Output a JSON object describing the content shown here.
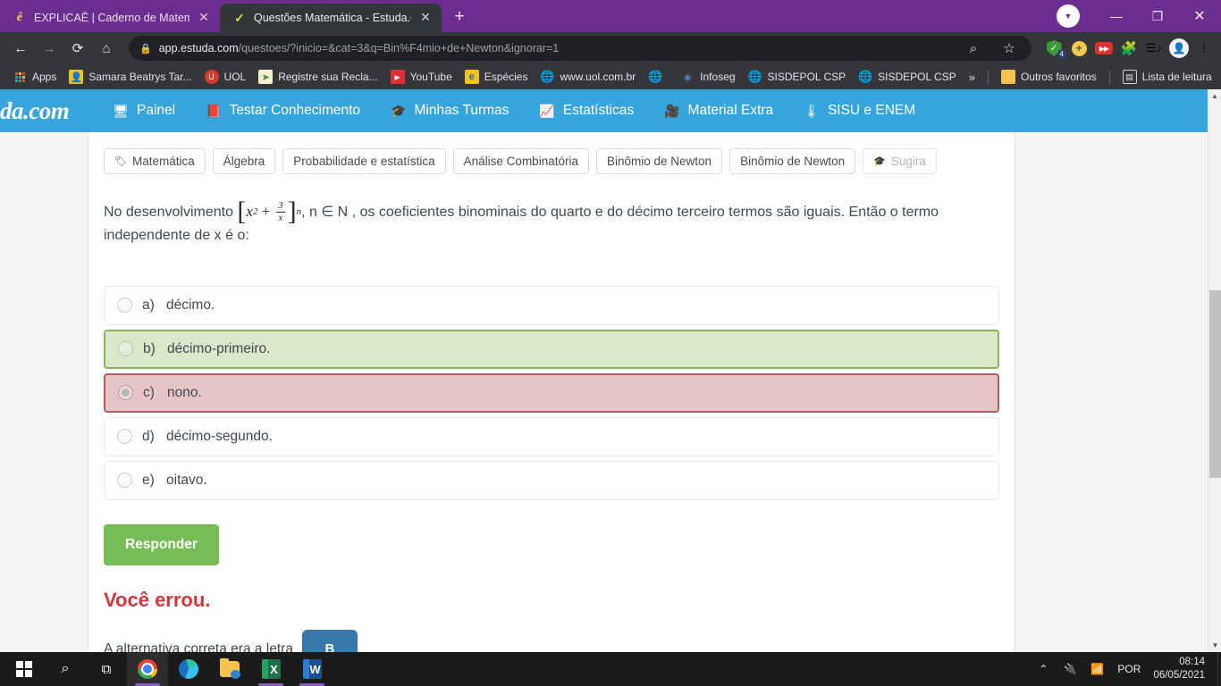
{
  "browser": {
    "tabs": [
      {
        "title": "EXPLICAÊ | Caderno de Matemáti",
        "favicon": "e-italic-icon",
        "active": false
      },
      {
        "title": "Questões Matemática - Estuda.co",
        "favicon": "green-check-icon",
        "active": true
      }
    ],
    "new_tab_label": "+",
    "window_controls": {
      "minimize": "—",
      "maximize": "❐",
      "close": "✕"
    },
    "nav": {
      "back": "←",
      "forward": "→",
      "reload": "⟳",
      "home": "⌂"
    },
    "omnibox": {
      "lock_icon": "lock-icon",
      "url_domain": "app.estuda.com",
      "url_path": "/questoes/?inicio=&cat=3&q=Bin%F4mio+de+Newton&ignorar=1",
      "zoom_icon": "magnifier-icon",
      "star_icon": "star-icon"
    },
    "extensions": [
      {
        "name": "adblock-shield-icon",
        "badge": "4"
      },
      {
        "name": "plus-circle-icon",
        "badge": ""
      },
      {
        "name": "youtube-downloader-icon",
        "badge": ""
      },
      {
        "name": "puzzle-extensions-icon",
        "badge": ""
      },
      {
        "name": "media-list-icon",
        "badge": ""
      },
      {
        "name": "profile-avatar-icon",
        "badge": ""
      },
      {
        "name": "chrome-menu-icon",
        "badge": ""
      }
    ],
    "bookmarks": [
      {
        "label": "Apps",
        "icon": "apps-grid-icon"
      },
      {
        "label": "Samara Beatrys Tar...",
        "icon": "contact-icon"
      },
      {
        "label": "UOL",
        "icon": "uol-icon"
      },
      {
        "label": "Registre sua Recla...",
        "icon": "arrow-badge-icon"
      },
      {
        "label": "YouTube",
        "icon": "youtube-icon"
      },
      {
        "label": "Espécies",
        "icon": "especies-icon"
      },
      {
        "label": "www.uol.com.br",
        "icon": "globe-icon"
      },
      {
        "label": "",
        "icon": "globe-icon"
      },
      {
        "label": "Infoseg",
        "icon": "infoseg-icon"
      },
      {
        "label": "SISDEPOL CSP",
        "icon": "globe-icon"
      },
      {
        "label": "SISDEPOL CSP",
        "icon": "globe-icon"
      }
    ],
    "bookmarks_overflow": "»",
    "bookmarks_right": [
      {
        "label": "Outros favoritos",
        "icon": "folder-icon"
      },
      {
        "label": "Lista de leitura",
        "icon": "reading-list-icon"
      }
    ]
  },
  "site": {
    "logo": "da.com",
    "accent_color": "#37a5dd",
    "nav_items": [
      {
        "label": "Painel",
        "icon": "monitor-icon"
      },
      {
        "label": "Testar Conhecimento",
        "icon": "book-icon"
      },
      {
        "label": "Minhas Turmas",
        "icon": "graduation-cap-icon"
      },
      {
        "label": "Estatísticas",
        "icon": "chart-icon"
      },
      {
        "label": "Material Extra",
        "icon": "video-camera-icon"
      },
      {
        "label": "SISU e ENEM",
        "icon": "thermometer-icon"
      }
    ]
  },
  "question": {
    "tags": [
      {
        "label": "Matemática",
        "icon": "tag-icon",
        "muted": false
      },
      {
        "label": "Álgebra",
        "icon": "",
        "muted": false
      },
      {
        "label": "Probabilidade e estatística",
        "icon": "",
        "muted": false
      },
      {
        "label": "Análise Combinatória",
        "icon": "",
        "muted": false
      },
      {
        "label": "Binômio de Newton",
        "icon": "",
        "muted": false
      },
      {
        "label": "Binômio de Newton",
        "icon": "",
        "muted": false
      },
      {
        "label": "Sugira",
        "icon": "graduation-cap-icon",
        "muted": true
      }
    ],
    "text_before_formula": "No desenvolvimento",
    "formula": {
      "open_bracket": "[",
      "base": "x",
      "base_exponent": "2",
      "operator": "+",
      "fraction_numerator": "3",
      "fraction_denominator": "x",
      "close_bracket": "]",
      "power": "n"
    },
    "text_after_formula": ", n ∈ N , os coeficientes binominais do quarto e do décimo terceiro termos são iguais. Então o termo independente de x é o:",
    "options": [
      {
        "letter": "a)",
        "text": "décimo.",
        "selected": false,
        "state": "neutral"
      },
      {
        "letter": "b)",
        "text": "décimo-primeiro.",
        "selected": false,
        "state": "correct"
      },
      {
        "letter": "c)",
        "text": "nono.",
        "selected": true,
        "state": "wrong"
      },
      {
        "letter": "d)",
        "text": "décimo-segundo.",
        "selected": false,
        "state": "neutral"
      },
      {
        "letter": "e)",
        "text": "oitavo.",
        "selected": false,
        "state": "neutral"
      }
    ],
    "submit_label": "Responder",
    "feedback_title": "Você errou.",
    "feedback_text": "A alternativa correta era a letra",
    "correct_letter": "B",
    "correct_letter_color": "#3778ab",
    "error_color": "#d9343a",
    "submit_color": "#76bd55"
  },
  "taskbar": {
    "items": [
      {
        "name": "start-button",
        "icon": "windows-logo-icon"
      },
      {
        "name": "search-button",
        "icon": "magnifier-icon"
      },
      {
        "name": "task-view-button",
        "icon": "task-view-icon"
      },
      {
        "name": "chrome-taskbar-item",
        "icon": "chrome-icon"
      },
      {
        "name": "edge-taskbar-item",
        "icon": "edge-icon"
      },
      {
        "name": "file-explorer-taskbar-item",
        "icon": "folder-icon"
      },
      {
        "name": "excel-taskbar-item",
        "icon": "excel-icon"
      },
      {
        "name": "word-taskbar-item",
        "icon": "word-icon"
      }
    ],
    "tray": {
      "chevron": "⌃",
      "battery_icon": "battery-charging-icon",
      "network_icon": "wifi-icon",
      "language": "POR",
      "time": "08:14",
      "date": "06/05/2021"
    }
  }
}
